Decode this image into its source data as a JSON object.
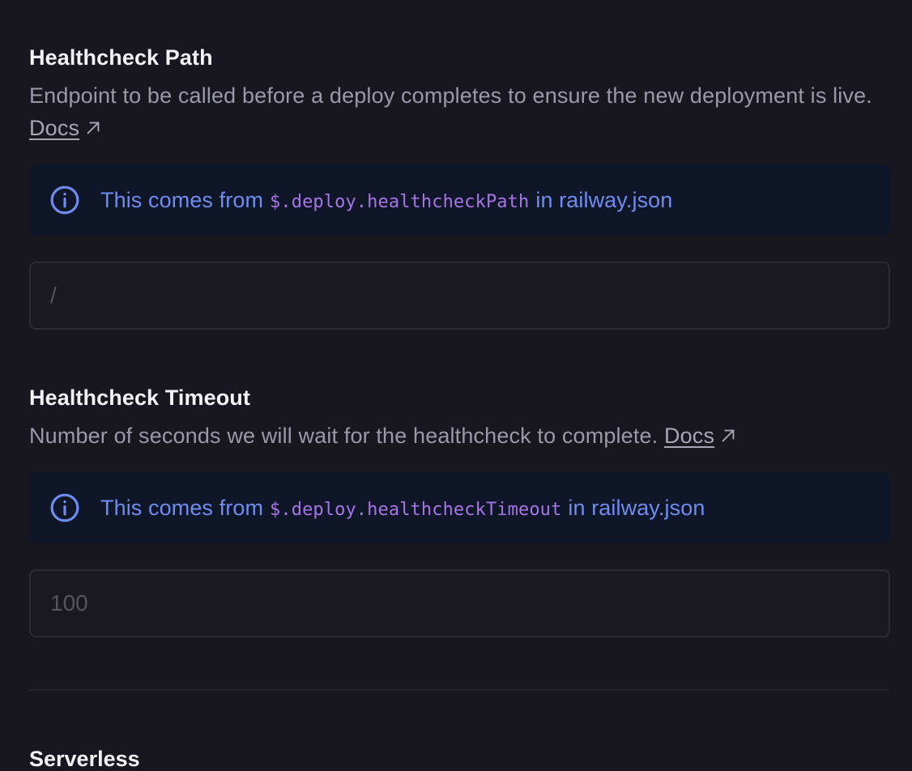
{
  "healthcheck_path": {
    "title": "Healthcheck Path",
    "description": "Endpoint to be called before a deploy completes to ensure the new deployment is live.",
    "docs_label": "Docs",
    "callout": {
      "prefix": "This comes from",
      "code": "$.deploy.healthcheckPath",
      "suffix": "in railway.json"
    },
    "input": {
      "value": "",
      "placeholder": "/"
    }
  },
  "healthcheck_timeout": {
    "title": "Healthcheck Timeout",
    "description": "Number of seconds we will wait for the healthcheck to complete.",
    "docs_label": "Docs",
    "callout": {
      "prefix": "This comes from",
      "code": "$.deploy.healthcheckTimeout",
      "suffix": "in railway.json"
    },
    "input": {
      "value": "",
      "placeholder": "100"
    }
  },
  "serverless": {
    "title": "Serverless"
  },
  "icons": {
    "info": "info-circle-icon",
    "external": "external-link-arrow-icon"
  },
  "colors": {
    "background": "#181720",
    "callout_background": "#0f1628",
    "callout_text": "#6f8df0",
    "code_text": "#a775e6"
  }
}
